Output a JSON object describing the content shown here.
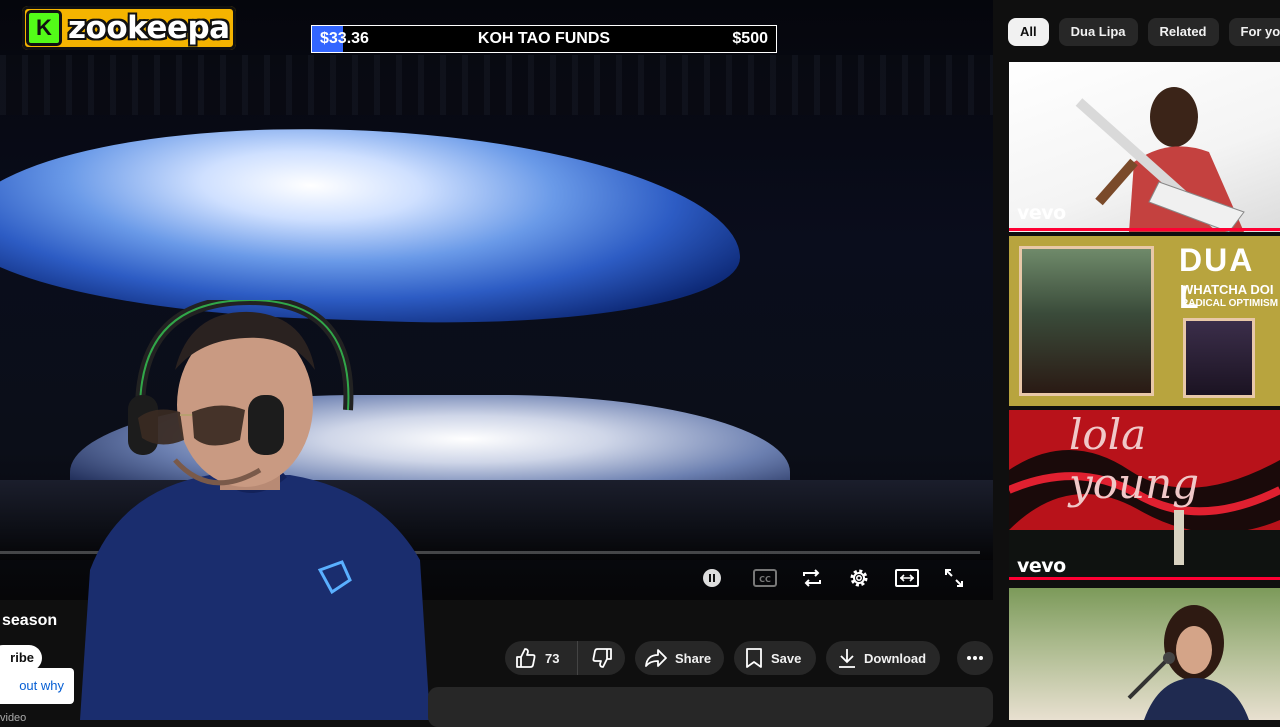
{
  "overlay": {
    "logo_initial": "K",
    "logo_text": "zookeepa",
    "funds": {
      "current": "$33.36",
      "title": "KOH TAO FUNDS",
      "goal": "$500",
      "progress": 0.067
    }
  },
  "player": {
    "controls": [
      "pause-icon",
      "captions-icon",
      "loop-icon",
      "settings-icon",
      "miniplayer-icon",
      "fullscreen-icon"
    ]
  },
  "below": {
    "title_fragment": "season",
    "subscribe_fragment": "ribe",
    "why_fragment": "out why",
    "desc_fragment": "video",
    "likes": "73",
    "share_label": "Share",
    "save_label": "Save",
    "download_label": "Download"
  },
  "chips": [
    {
      "label": "All",
      "active": true
    },
    {
      "label": "Dua Lipa",
      "active": false
    },
    {
      "label": "Related",
      "active": false
    },
    {
      "label": "For you",
      "active": false
    }
  ],
  "thumbnails": {
    "t1": {
      "badge": "vevo"
    },
    "t2": {
      "line1": "DUA L",
      "line2": "WHATCHA DOI",
      "line3": "RADICAL OPTIMISM"
    },
    "t3": {
      "script": "lola young",
      "badge": "vevo"
    }
  },
  "colors": {
    "accent_red": "#ff0033",
    "kick_green": "#53fc18",
    "logo_gold": "#f5b400",
    "funds_fill": "#3366ff"
  }
}
